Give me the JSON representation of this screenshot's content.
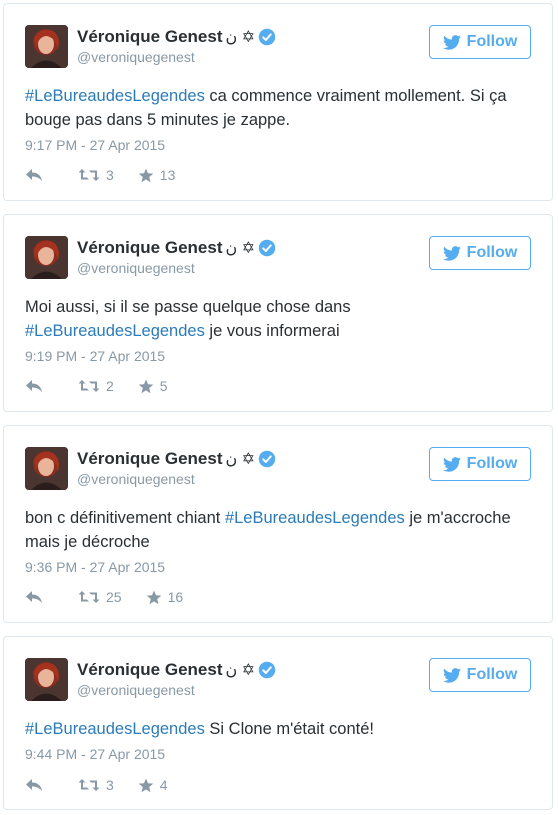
{
  "tweets": [
    {
      "author": {
        "name": "Véronique Genest",
        "name_suffix": "ن ✡",
        "handle": "@veroniquegenest"
      },
      "follow_label": "Follow",
      "hashtag": "#LeBureaudesLegendes",
      "text_before": "",
      "text_after": " ca commence vraiment mollement. Si ça bouge pas dans 5 minutes je zappe.",
      "timestamp": "9:17 PM - 27 Apr 2015",
      "retweets": "3",
      "likes": "13"
    },
    {
      "author": {
        "name": "Véronique Genest",
        "name_suffix": "ن ✡",
        "handle": "@veroniquegenest"
      },
      "follow_label": "Follow",
      "hashtag": "#LeBureaudesLegendes",
      "text_before": "Moi aussi, si il se passe quelque chose dans ",
      "text_after": " je vous informerai",
      "timestamp": "9:19 PM - 27 Apr 2015",
      "retweets": "2",
      "likes": "5"
    },
    {
      "author": {
        "name": "Véronique Genest",
        "name_suffix": "ن ✡",
        "handle": "@veroniquegenest"
      },
      "follow_label": "Follow",
      "hashtag": "#LeBureaudesLegendes",
      "text_before": "bon c définitivement chiant ",
      "text_after": " je m'accroche mais je décroche",
      "timestamp": "9:36 PM - 27 Apr 2015",
      "retweets": "25",
      "likes": "16"
    },
    {
      "author": {
        "name": "Véronique Genest",
        "name_suffix": "ن ✡",
        "handle": "@veroniquegenest"
      },
      "follow_label": "Follow",
      "hashtag": "#LeBureaudesLegendes",
      "text_before": "",
      "text_after": " Si Clone m'était conté!",
      "timestamp": "9:44 PM - 27 Apr 2015",
      "retweets": "3",
      "likes": "4"
    }
  ],
  "colors": {
    "twitter_blue": "#55acee",
    "hashtag_blue": "#2b7bb9",
    "meta_gray": "#8899a6",
    "text": "#292f33",
    "border": "#e1e8ed"
  },
  "icons": [
    "avatar",
    "verified-badge-icon",
    "twitter-bird-icon",
    "reply-icon",
    "retweet-icon",
    "star-icon"
  ]
}
